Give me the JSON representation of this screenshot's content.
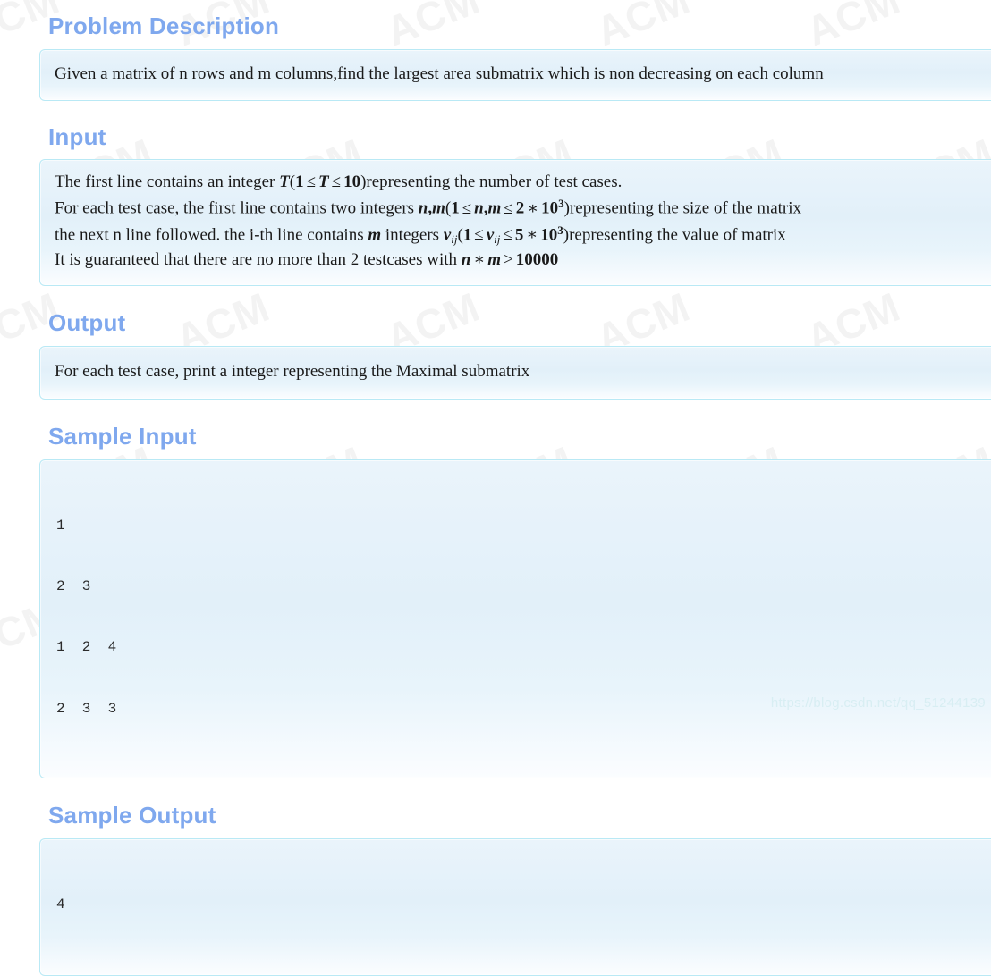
{
  "watermark": {
    "tile_text": "ACM",
    "source_url": "https://blog.csdn.net/qq_51244139",
    "heading_color": "#7fa8ee",
    "panel_border_color": "#b9e9f5"
  },
  "sections": {
    "problem_description": {
      "heading": "Problem Description",
      "body": "Given a matrix of n rows and m columns,find the largest area submatrix which is non decreasing on each column"
    },
    "input": {
      "heading": "Input",
      "line1": {
        "pre": "The first line contains an integer ",
        "math_T": "T",
        "paren_open": "(",
        "one": "1",
        "le1": "≤",
        "var": "T",
        "le2": "≤",
        "ten": "10",
        "paren_close": ")",
        "post": "representing the number of test cases."
      },
      "line2": {
        "pre": "For each test case, the first line contains two integers ",
        "n": "n",
        "comma": ",",
        "m": "m",
        "paren_open": "(",
        "one": "1",
        "le1": "≤",
        "n2": "n",
        "comma2": ",",
        "m2": "m",
        "le2": "≤",
        "two": "2",
        "times": "∗",
        "ten": "10",
        "exp": "3",
        "paren_close": ")",
        "post": "representing the size of the matrix"
      },
      "line3": {
        "pre": "the next n line followed. the i-th line contains ",
        "m": "m",
        "mid": " integers ",
        "v": "v",
        "vsub": "ij",
        "paren_open": "(",
        "one": "1",
        "le1": "≤",
        "v2": "v",
        "vsub2": "ij",
        "le2": "≤",
        "five": "5",
        "times": "∗",
        "ten": "10",
        "exp": "3",
        "paren_close": ")",
        "post": "representing the value of matrix"
      },
      "line4": {
        "pre": "It is guaranteed that there are no more than 2 testcases with ",
        "n": "n",
        "times": "∗",
        "m": "m",
        "gt": ">",
        "value": "10000"
      }
    },
    "output": {
      "heading": "Output",
      "body": "For each test case, print a integer representing the Maximal submatrix"
    },
    "sample_input": {
      "heading": "Sample Input",
      "lines": [
        "1",
        "2  3",
        "1  2  4",
        "2  3  3"
      ]
    },
    "sample_output": {
      "heading": "Sample Output",
      "lines": [
        "4"
      ]
    }
  }
}
